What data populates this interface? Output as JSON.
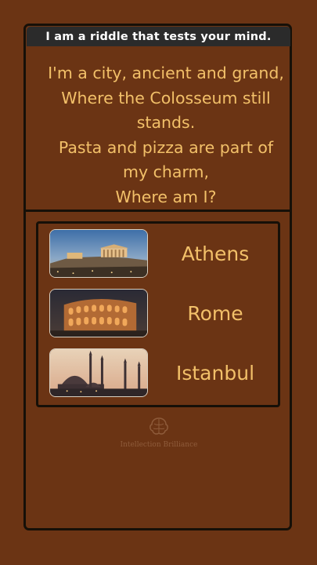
{
  "header": {
    "title": "I am a riddle that tests your mind."
  },
  "riddle": {
    "text": "I'm a city, ancient and grand,\nWhere the Colosseum still\nstands.\nPasta and pizza are part of\nmy charm,\nWhere am I?"
  },
  "options": [
    {
      "label": "Athens",
      "image": "acropolis-photo"
    },
    {
      "label": "Rome",
      "image": "colosseum-photo"
    },
    {
      "label": "Istanbul",
      "image": "blue-mosque-photo"
    }
  ],
  "watermark": {
    "text": "Intellection Brilliance",
    "icon": "brain-logo-icon"
  },
  "colors": {
    "background": "#6b3414",
    "accent_text": "#f2c069",
    "header_bg": "#2b2b2b",
    "border": "#161008"
  }
}
